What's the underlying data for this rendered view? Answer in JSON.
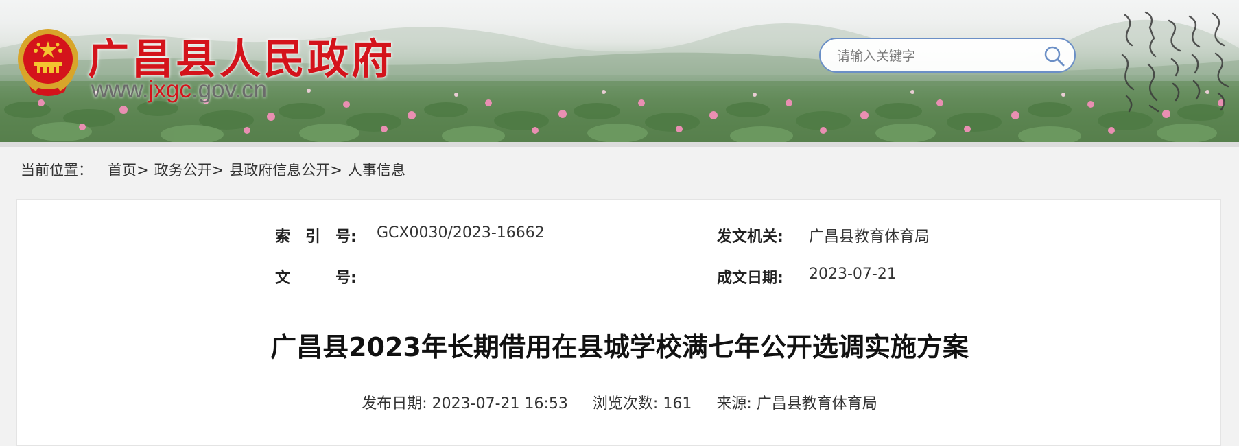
{
  "header": {
    "site_title": "广昌县人民政府",
    "site_url_prefix": "www.",
    "site_url_highlight": "jxgc",
    "site_url_suffix": ".gov.cn",
    "search": {
      "placeholder": "请输入关键字",
      "value": ""
    },
    "icons": {
      "emblem": "national-emblem-icon",
      "search": "search-icon",
      "calligraphy": "calligraphy-image"
    }
  },
  "breadcrumb": {
    "label": "当前位置：",
    "items": [
      "首页",
      "政务公开",
      "县政府信息公开",
      "人事信息"
    ],
    "separator": ">"
  },
  "meta": {
    "index_label": "索　引　号:",
    "index_value": "GCX0030/2023-16662",
    "issuer_label": "发文机关:",
    "issuer_value": "广昌县教育体育局",
    "docno_label": "文　　　号:",
    "docno_value": "",
    "date_label": "成文日期:",
    "date_value": "2023-07-21"
  },
  "article": {
    "title": "广昌县2023年长期借用在县城学校满七年公开选调实施方案",
    "publish_label": "发布日期:",
    "publish_value": "2023-07-21 16:53",
    "views_label": "浏览次数:",
    "views_value": "161",
    "source_label": "来源:",
    "source_value": "广昌县教育体育局"
  },
  "colors": {
    "title_red": "#d4131b",
    "search_border": "#6b8fc6",
    "page_bg": "#f2f2f2"
  }
}
